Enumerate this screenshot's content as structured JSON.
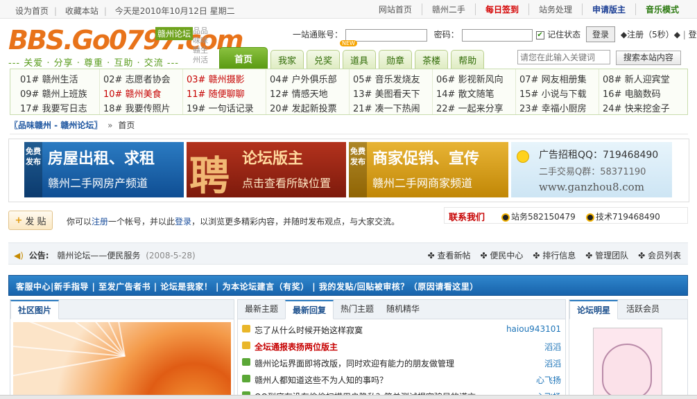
{
  "topbar": {
    "left": [
      "设为首页",
      "收藏本站",
      "今天是2010年10月12日 星期二"
    ],
    "right": [
      {
        "label": "网站首页",
        "color": "#555555"
      },
      {
        "label": "赣州二手",
        "color": "#555555"
      },
      {
        "label": "每日签到",
        "color": "#d40000"
      },
      {
        "label": "站务处理",
        "color": "#555555"
      },
      {
        "label": "申请版主",
        "color": "#1c3f95"
      },
      {
        "label": "音乐模式",
        "color": "#2c7a10"
      }
    ]
  },
  "logo": {
    "text": "BBS.Go0797.com",
    "tag": "赣州论坛",
    "side": "品品味味赣生州活",
    "slogan": "--- 关爱 · 分享 · 尊重 · 互助 · 交流 ---"
  },
  "login": {
    "account_label": "一站通账号：",
    "password_label": "密码：",
    "remember": "记住状态",
    "login_button": "登录",
    "register": "◆注册（5秒）◆",
    "login_link": "登录"
  },
  "nav_tabs": [
    "首页",
    "我家",
    "兑奖",
    "道具",
    "勋章",
    "茶楼",
    "帮助"
  ],
  "new_badge": "NEW",
  "search": {
    "placeholder": "请您在此输入关键词",
    "button": "搜索本站内容"
  },
  "forums": [
    [
      "01# 赣州生活",
      "02# 志愿者协会",
      "03# 赣州摄影",
      "04# 户外俱乐部",
      "05# 音乐发烧友",
      "06# 影视新风向",
      "07# 网友相册集",
      "08# 新人迎宾堂"
    ],
    [
      "09# 赣州上班族",
      "10# 赣州美食",
      "11# 随便聊聊",
      "12# 情感天地",
      "13# 美图看天下",
      "14# 散文随笔",
      "15# 小说与下载",
      "16# 电脑数码"
    ],
    [
      "17# 我要写日志",
      "18# 我要传照片",
      "19# 一句话记录",
      "20# 发起新投票",
      "21# 凑一下热闹",
      "22# 一起来分享",
      "23# 幸福小厨房",
      "24# 快来挖金子"
    ]
  ],
  "breadcrumb": {
    "site": "〖品味赣州 - 赣州论坛〗",
    "arrow": "»",
    "current": "首页"
  },
  "ads": {
    "ad1": {
      "free": "免费发布",
      "line1": "房屋出租、求租",
      "line2": "赣州二手网房产频道"
    },
    "ad2": {
      "big": "聘",
      "line1": "论坛版主",
      "line2": "点击查看所缺位置"
    },
    "ad3": {
      "free": "免费发布",
      "line1": "商家促销、宣传",
      "line2": "赣州二手网商家频道"
    },
    "ad4": {
      "line1": "广告招租QQ：719468490",
      "line2": "二手交易Q群：58371190",
      "line3": "www.ganzhou8.com"
    }
  },
  "post_button": "发 贴",
  "post_notice": {
    "pre": "你可以",
    "register": "注册",
    "mid": "一个帐号，并以此",
    "login": "登录",
    "post": "，以浏览更多精彩内容，并随时发布观点，与大家交流。"
  },
  "contact": {
    "title": "联系我们",
    "service": "站务582150479",
    "tech": "技术719468490"
  },
  "notice": {
    "label": "公告:",
    "text": "赣州论坛——便民服务",
    "date": "(2008-5-28)",
    "links": [
      "查看新帖",
      "便民中心",
      "排行信息",
      "管理团队",
      "会员列表"
    ]
  },
  "bluebar": "客服中心|新手指导 | 至发广告者书 | 论坛是我家！ | 为本论坛建言（有奖） | 我的发贴/回贴被审核？（原因请看这里）",
  "photos_panel": {
    "title": "社区图片"
  },
  "posts_panel": {
    "tabs": [
      "最新主题",
      "最新回复",
      "热门主题",
      "随机精华"
    ],
    "rows": [
      {
        "title": "忘了从什么时候开始这样寂寞",
        "author": "haiou943101",
        "red": false
      },
      {
        "title": "全坛通报表扬两位版主",
        "author": "滔滔",
        "red": true
      },
      {
        "title": "赣州论坛界面即将改版，同时欢迎有能力的朋友做管理",
        "author": "滔滔",
        "red": false
      },
      {
        "title": "赣州人都知道这些不为人知的事吗？",
        "author": "心飞扬",
        "red": false
      },
      {
        "title": "QQ到底有没有偷偷扫描用户隐私？简单测试揭穿骗局的谎言",
        "author": "心飞扬",
        "red": false
      }
    ]
  },
  "stars_panel": {
    "tabs": [
      "论坛明星",
      "活跃会员"
    ]
  }
}
